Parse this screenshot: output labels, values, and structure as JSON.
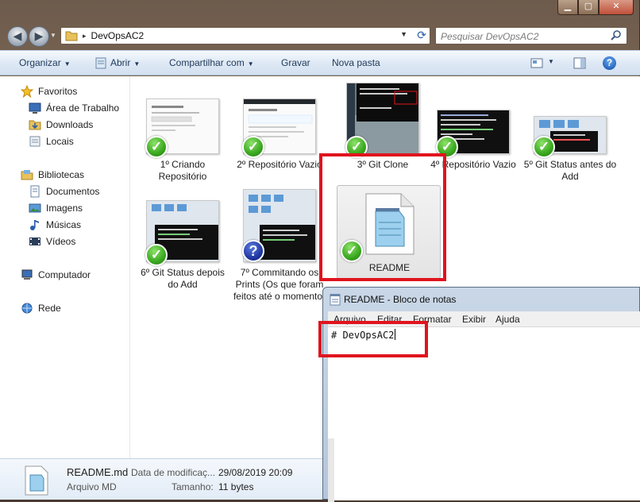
{
  "window": {
    "controls": [
      "minimize",
      "maximize",
      "close"
    ]
  },
  "address": {
    "path": "DevOpsAC2",
    "separator": "▸"
  },
  "search": {
    "placeholder": "Pesquisar DevOpsAC2"
  },
  "toolbar": {
    "organize": "Organizar",
    "open": "Abrir",
    "share": "Compartilhar com",
    "burn": "Gravar",
    "new_folder": "Nova pasta"
  },
  "sidebar": {
    "favorites": "Favoritos",
    "desktop": "Área de Trabalho",
    "downloads": "Downloads",
    "places": "Locais",
    "libraries": "Bibliotecas",
    "documents": "Documentos",
    "images": "Imagens",
    "music": "Músicas",
    "videos": "Vídeos",
    "computer": "Computador",
    "network": "Rede"
  },
  "files": [
    {
      "label": "1º Criando Repositório",
      "status": "synced"
    },
    {
      "label": "2º Repositório Vazio",
      "status": "synced"
    },
    {
      "label": "3º Git Clone",
      "status": "synced"
    },
    {
      "label": "4º Repositório Vazio",
      "status": "synced"
    },
    {
      "label": "5º Git Status antes do Add",
      "status": "synced"
    },
    {
      "label": "6º Git Status depois do Add",
      "status": "synced"
    },
    {
      "label": "7º Commitando os Prints (Os que foram feitos até o momento)",
      "status": "unknown"
    },
    {
      "label": "README",
      "status": "synced",
      "selected": true
    }
  ],
  "status_bar": {
    "filename": "README.md",
    "type": "Arquivo MD",
    "modified_label": "Data de modificaç...",
    "modified_value": "29/08/2019 20:09",
    "size_label": "Tamanho:",
    "size_value": "11 bytes"
  },
  "notepad": {
    "title": "README - Bloco de notas",
    "menu": [
      "Arquivo",
      "Editar",
      "Formatar",
      "Exibir",
      "Ajuda"
    ],
    "content": "# DevOpsAC2"
  },
  "colors": {
    "highlight_red": "#e0141e",
    "check_green": "#3aa81f",
    "question_blue": "#1a2f9a"
  }
}
